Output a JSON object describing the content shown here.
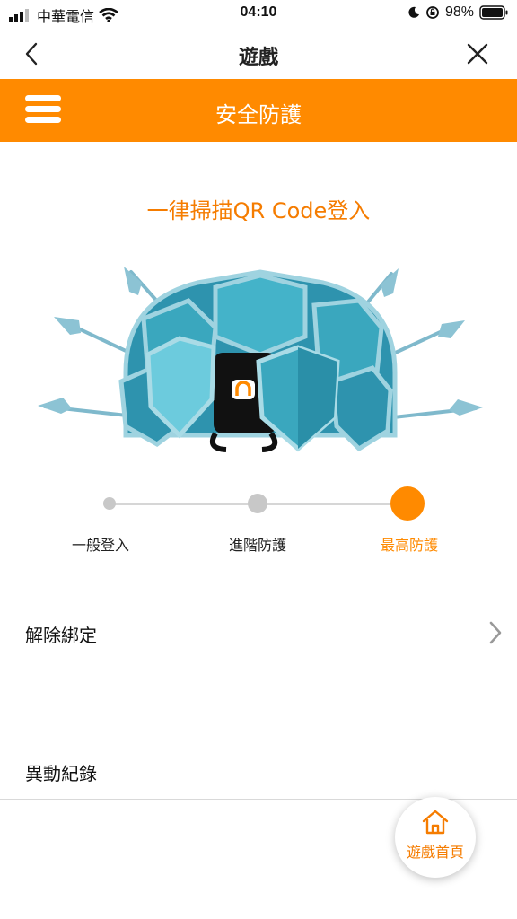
{
  "status_bar": {
    "carrier": "中華電信",
    "time": "04:10",
    "battery": "98%"
  },
  "nav": {
    "title": "遊戲",
    "back_icon": "chevron-left-icon",
    "close_icon": "close-icon"
  },
  "header": {
    "title": "安全防護",
    "menu_icon": "hamburger-icon",
    "color": "#FF8A00"
  },
  "main": {
    "headline": "一律掃描QR Code登入",
    "levels": [
      {
        "label": "一般登入",
        "selected": false
      },
      {
        "label": "進階防護",
        "selected": false
      },
      {
        "label": "最高防護",
        "selected": true
      }
    ]
  },
  "list": [
    {
      "label": "解除綁定",
      "icon": "chevron-right-icon"
    },
    {
      "label": "異動紀錄"
    }
  ],
  "fab": {
    "label": "遊戲首頁",
    "icon": "home-icon"
  },
  "colors": {
    "accent": "#FF8A00",
    "shield": "#3AA7BE",
    "shield_light": "#6CCBDD",
    "spear": "#7FB9CC"
  }
}
